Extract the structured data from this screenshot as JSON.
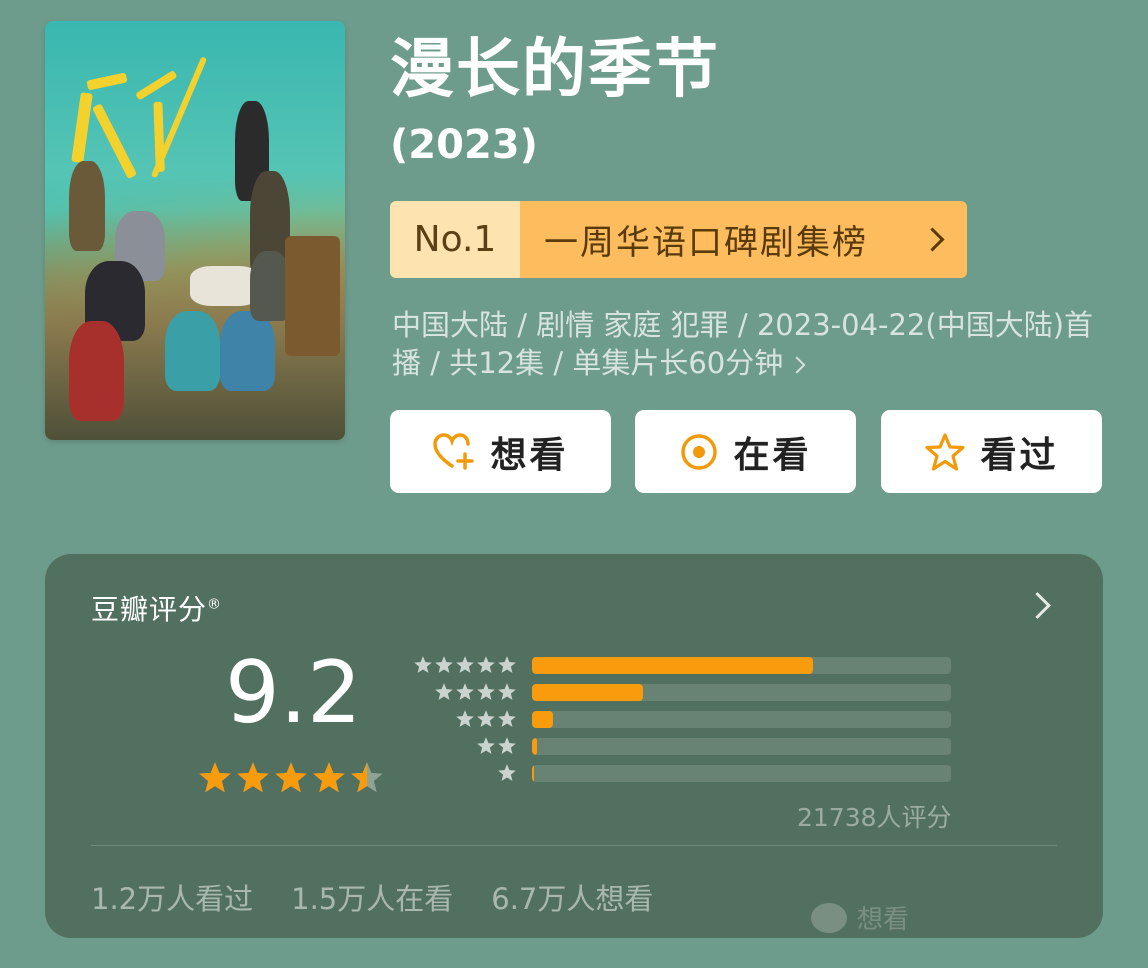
{
  "title": "漫长的季节",
  "year": "(2023)",
  "rank": {
    "number": "No.1",
    "list_name": "一周华语口碑剧集榜"
  },
  "meta": "中国大陆 / 剧情 家庭 犯罪 / 2023-04-22(中国大陆)首播 / 共12集 / 单集片长60分钟",
  "buttons": {
    "want": "想看",
    "watching": "在看",
    "watched": "看过"
  },
  "rating": {
    "header": "豆瓣评分",
    "registered_mark": "®",
    "score": "9.2",
    "stars": 4.5,
    "distribution": [
      {
        "stars": 5,
        "fraction": 0.67
      },
      {
        "stars": 4,
        "fraction": 0.265
      },
      {
        "stars": 3,
        "fraction": 0.05
      },
      {
        "stars": 2,
        "fraction": 0.012
      },
      {
        "stars": 1,
        "fraction": 0.005
      }
    ],
    "votes": "21738人评分"
  },
  "stats": {
    "watched": "1.2万人看过",
    "watching": "1.5万人在看",
    "want": "6.7万人想看"
  },
  "watermark": "想看",
  "colors": {
    "background": "#6e9c8c",
    "accent": "#f89b0c",
    "rank_badge": "#fdbc5e"
  },
  "icons": {
    "want": "heart-plus-icon",
    "watching": "target-icon",
    "watched": "star-outline-icon"
  }
}
